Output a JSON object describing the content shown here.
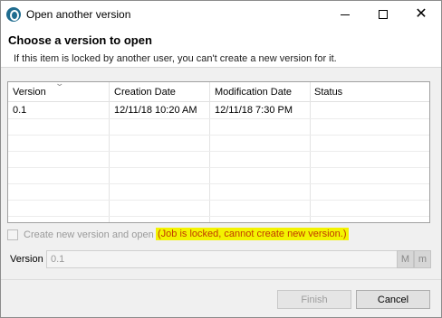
{
  "window": {
    "title": "Open another version",
    "icon": "talend-app-icon",
    "controls": {
      "minimize": "minimize-icon",
      "maximize": "maximize-icon",
      "close": "close-icon"
    }
  },
  "header": {
    "title": "Choose a version to open",
    "message": "If this item is locked by another user, you can't create a new version for it."
  },
  "table": {
    "columns": [
      "Version",
      "Creation Date",
      "Modification Date",
      "Status"
    ],
    "rows": [
      {
        "version": "0.1",
        "creation_date": "12/11/18 10:20 AM",
        "modification_date": "12/11/18 7:30 PM",
        "status": ""
      }
    ]
  },
  "create_new": {
    "label": "Create new version and open",
    "checked": false,
    "lock_message": "(Job is locked, cannot create new version.)"
  },
  "version": {
    "label": "Version",
    "value": "0.1",
    "major_button": "M",
    "minor_button": "m"
  },
  "buttons": {
    "finish": "Finish",
    "cancel": "Cancel"
  },
  "colors": {
    "lock_highlight": "#f3f300",
    "lock_text": "#c03a00"
  }
}
